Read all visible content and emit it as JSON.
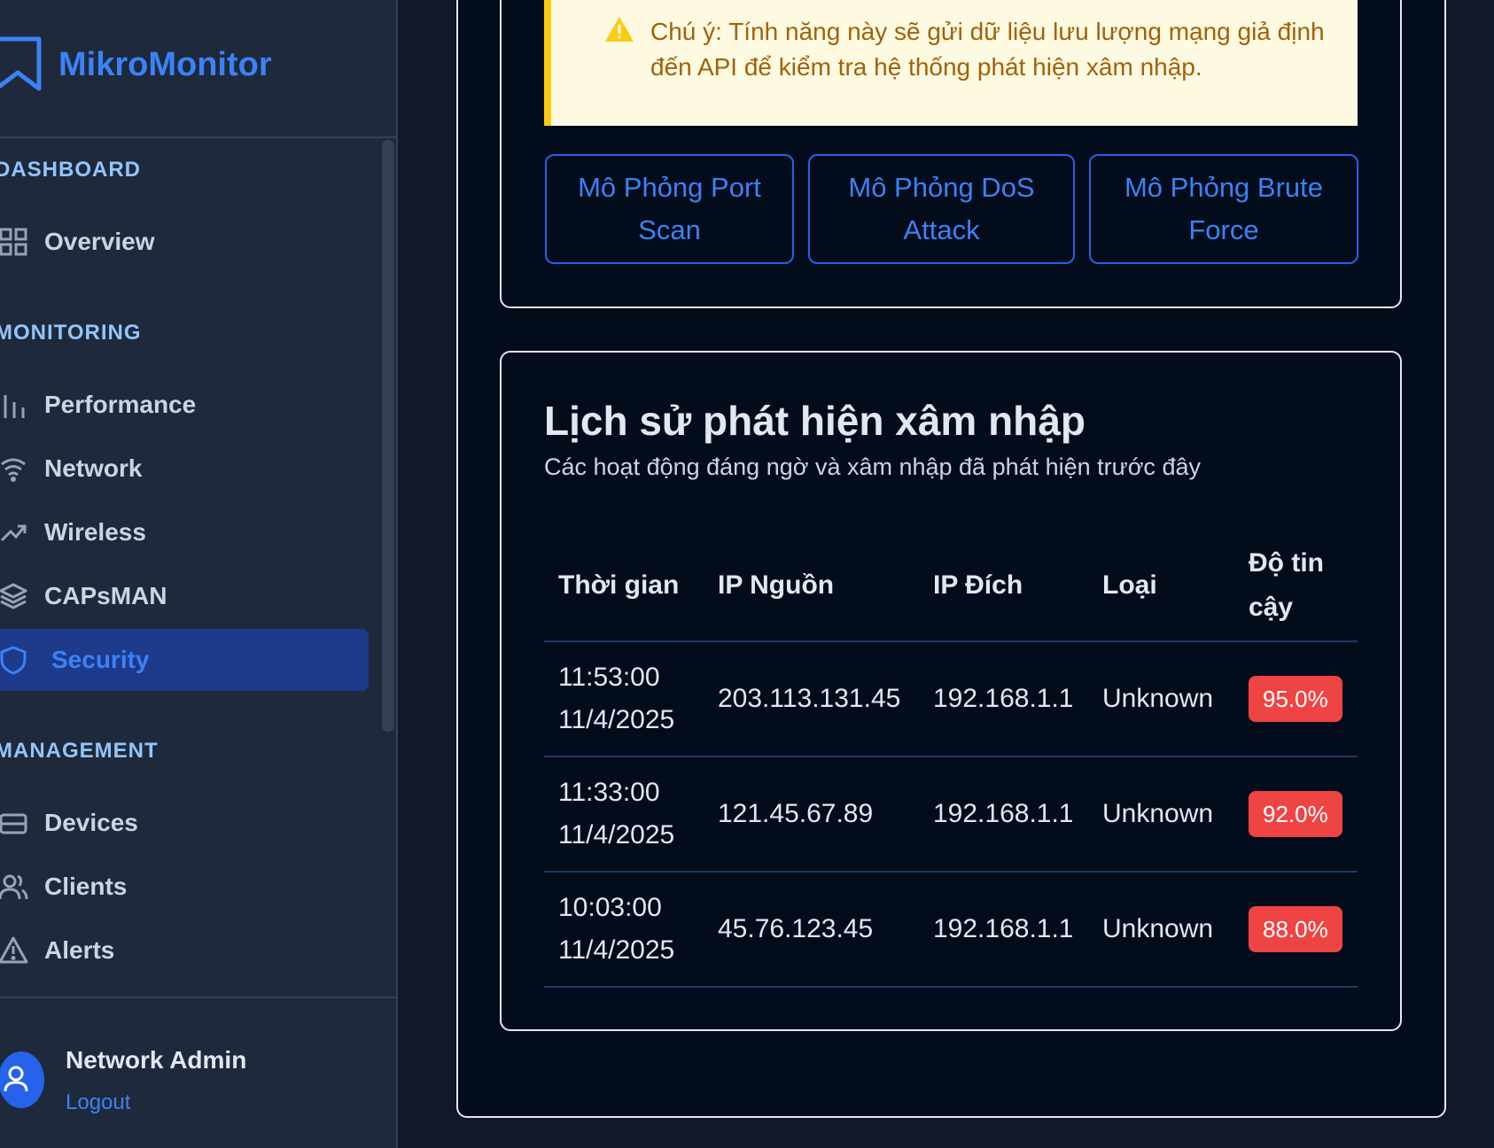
{
  "app": {
    "name": "MikroMonitor"
  },
  "sidebar": {
    "sections": [
      {
        "title": "DASHBOARD",
        "items": [
          {
            "label": "Overview",
            "icon": "grid-icon"
          }
        ]
      },
      {
        "title": "MONITORING",
        "items": [
          {
            "label": "Performance",
            "icon": "bar-chart-icon"
          },
          {
            "label": "Network",
            "icon": "wifi-icon"
          },
          {
            "label": "Wireless",
            "icon": "trending-up-icon"
          },
          {
            "label": "CAPsMAN",
            "icon": "layers-icon"
          },
          {
            "label": "Security",
            "icon": "shield-icon",
            "active": true
          }
        ]
      },
      {
        "title": "MANAGEMENT",
        "items": [
          {
            "label": "Devices",
            "icon": "server-icon"
          },
          {
            "label": "Clients",
            "icon": "users-icon"
          },
          {
            "label": "Alerts",
            "icon": "alert-triangle-icon"
          }
        ]
      }
    ],
    "user": {
      "name": "Network Admin",
      "logout": "Logout"
    }
  },
  "simulation": {
    "warning": "Chú ý: Tính năng này sẽ gửi dữ liệu lưu lượng mạng giả định đến API để kiểm tra hệ thống phát hiện xâm nhập.",
    "buttons": [
      "Mô Phỏng Port Scan",
      "Mô Phỏng DoS Attack",
      "Mô Phỏng Brute Force"
    ]
  },
  "history": {
    "title": "Lịch sử phát hiện xâm nhập",
    "subtitle": "Các hoạt động đáng ngờ và xâm nhập đã phát hiện trước đây",
    "columns": [
      "Thời gian",
      "IP Nguồn",
      "IP Đích",
      "Loại",
      "Độ tin cậy"
    ],
    "rows": [
      {
        "time": "11:53:00 11/4/2025",
        "src": "203.113.131.45",
        "dst": "192.168.1.1",
        "type": "Unknown",
        "confidence": "95.0%"
      },
      {
        "time": "11:33:00 11/4/2025",
        "src": "121.45.67.89",
        "dst": "192.168.1.1",
        "type": "Unknown",
        "confidence": "92.0%"
      },
      {
        "time": "10:03:00 11/4/2025",
        "src": "45.76.123.45",
        "dst": "192.168.1.1",
        "type": "Unknown",
        "confidence": "88.0%"
      }
    ]
  },
  "colors": {
    "accent": "#3b82f6",
    "sidebar": "#1e293b",
    "active": "#1e3a8a",
    "badge": "#ef4444",
    "warning_bg": "#fef9e1",
    "warning_border": "#facc15"
  }
}
